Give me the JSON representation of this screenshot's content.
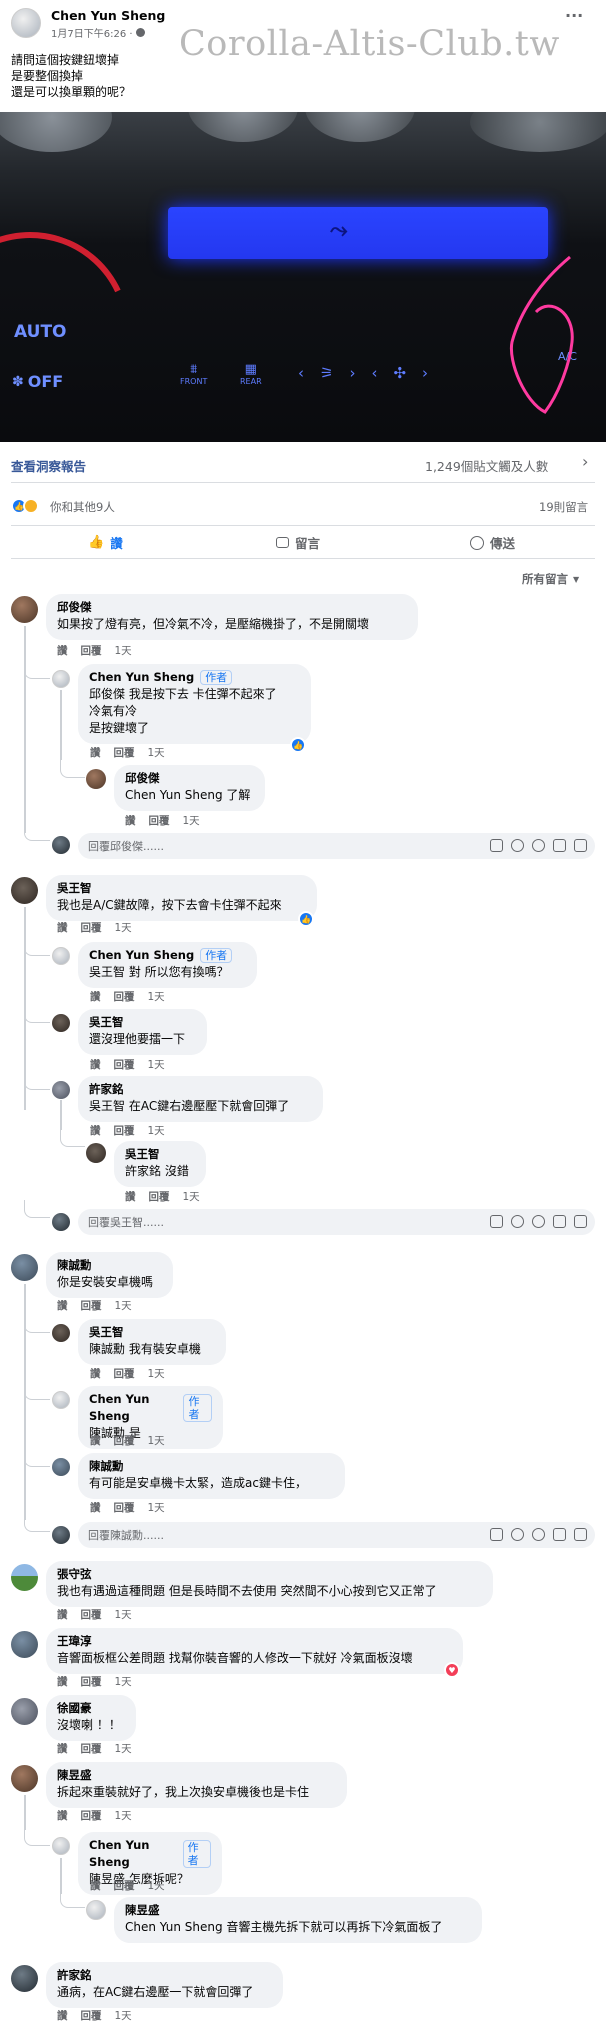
{
  "post": {
    "author": "Chen Yun Sheng",
    "time": "1月7日下午6:26 ·",
    "watermark": "Corolla-Altis-Club.tw",
    "text": [
      "請問這個按鍵鈕壞掉",
      "是要整個換掉",
      "還是可以換單顆的呢？"
    ],
    "more": "···"
  },
  "photo": {
    "auto_label": "AUTO",
    "off_label": "OFF",
    "front_label": "FRONT",
    "rear_label": "REAR",
    "ac_label": "A/C"
  },
  "insights": {
    "link": "查看洞察報告",
    "stat": "1,249個貼文觸及人數"
  },
  "reactions": {
    "summary": "你和其他9人",
    "comments": "19則留言"
  },
  "actions": {
    "like": "讚",
    "comment": "留言",
    "share": "傳送"
  },
  "sort": "所有留言",
  "labels": {
    "like": "讚",
    "reply": "回覆",
    "author_badge": "作者"
  },
  "comments": [
    {
      "name": "邱俊傑",
      "text": "如果按了燈有亮，但冷氣不冷，是壓縮機掛了，不是開關壞",
      "time": "1天"
    },
    {
      "name": "Chen Yun Sheng",
      "text1": "邱俊傑 我是按下去 卡住彈不起來了",
      "text2": "冷氣有冷",
      "text3": "是按鍵壞了",
      "time": "1天"
    },
    {
      "name": "邱俊傑",
      "text": "Chen Yun Sheng 了解",
      "time": "1天"
    },
    {
      "placeholder": "回覆邱俊傑......"
    },
    {
      "name": "吳王智",
      "text": "我也是A/C鍵故障，按下去會卡住彈不起來",
      "time": "1天"
    },
    {
      "name": "Chen Yun Sheng",
      "text": "吳王智 對 所以您有換嗎？",
      "time": "1天"
    },
    {
      "name": "吳王智",
      "text": "還沒理他要擂一下",
      "time": "1天"
    },
    {
      "name": "許家銘",
      "text": "吳王智 在AC鍵右邊壓壓下就會回彈了",
      "time": "1天"
    },
    {
      "name": "吳王智",
      "text": "許家銘 沒錯",
      "time": "1天"
    },
    {
      "placeholder": "回覆吳王智......"
    },
    {
      "name": "陳誠勳",
      "text": "你是安裝安卓機嗎",
      "time": "1天"
    },
    {
      "name": "吳王智",
      "text": "陳誠勳 我有裝安卓機",
      "time": "1天"
    },
    {
      "name": "Chen Yun Sheng",
      "text": "陳誠勳 是",
      "time": "1天"
    },
    {
      "name": "陳誠勳",
      "text": "有可能是安卓機卡太緊，造成ac鍵卡住，",
      "time": "1天"
    },
    {
      "placeholder": "回覆陳誠勳......"
    },
    {
      "name": "張守弦",
      "text": "我也有遇過這種問題 但是長時間不去使用 突然間不小心按到它又正常了",
      "time": "1天"
    },
    {
      "name": "王瑋淳",
      "text": "音響面板框公差問題 找幫你裝音響的人修改一下就好 冷氣面板沒壞",
      "time": "1天"
    },
    {
      "name": "徐國豪",
      "text": "沒壞喇 ！！",
      "time": "1天"
    },
    {
      "name": "陳昱盛",
      "text": "拆起來重裝就好了，我上次換安卓機後也是卡住",
      "time": "1天"
    },
    {
      "name": "Chen Yun Sheng",
      "text": "陳昱盛 怎麼拆呢？",
      "time": "1天"
    },
    {
      "name": "陳昱盛",
      "text": "Chen Yun Sheng 音響主機先拆下就可以再拆下冷氣面板了",
      "time": "1天"
    },
    {
      "name": "許家銘",
      "text": "通病，在AC鍵右邊壓一下就會回彈了",
      "time": "1天"
    }
  ],
  "colors": {
    "link": "#385898",
    "brand": "#1877f2",
    "muted": "#65676b",
    "bubble": "#f0f2f5"
  }
}
